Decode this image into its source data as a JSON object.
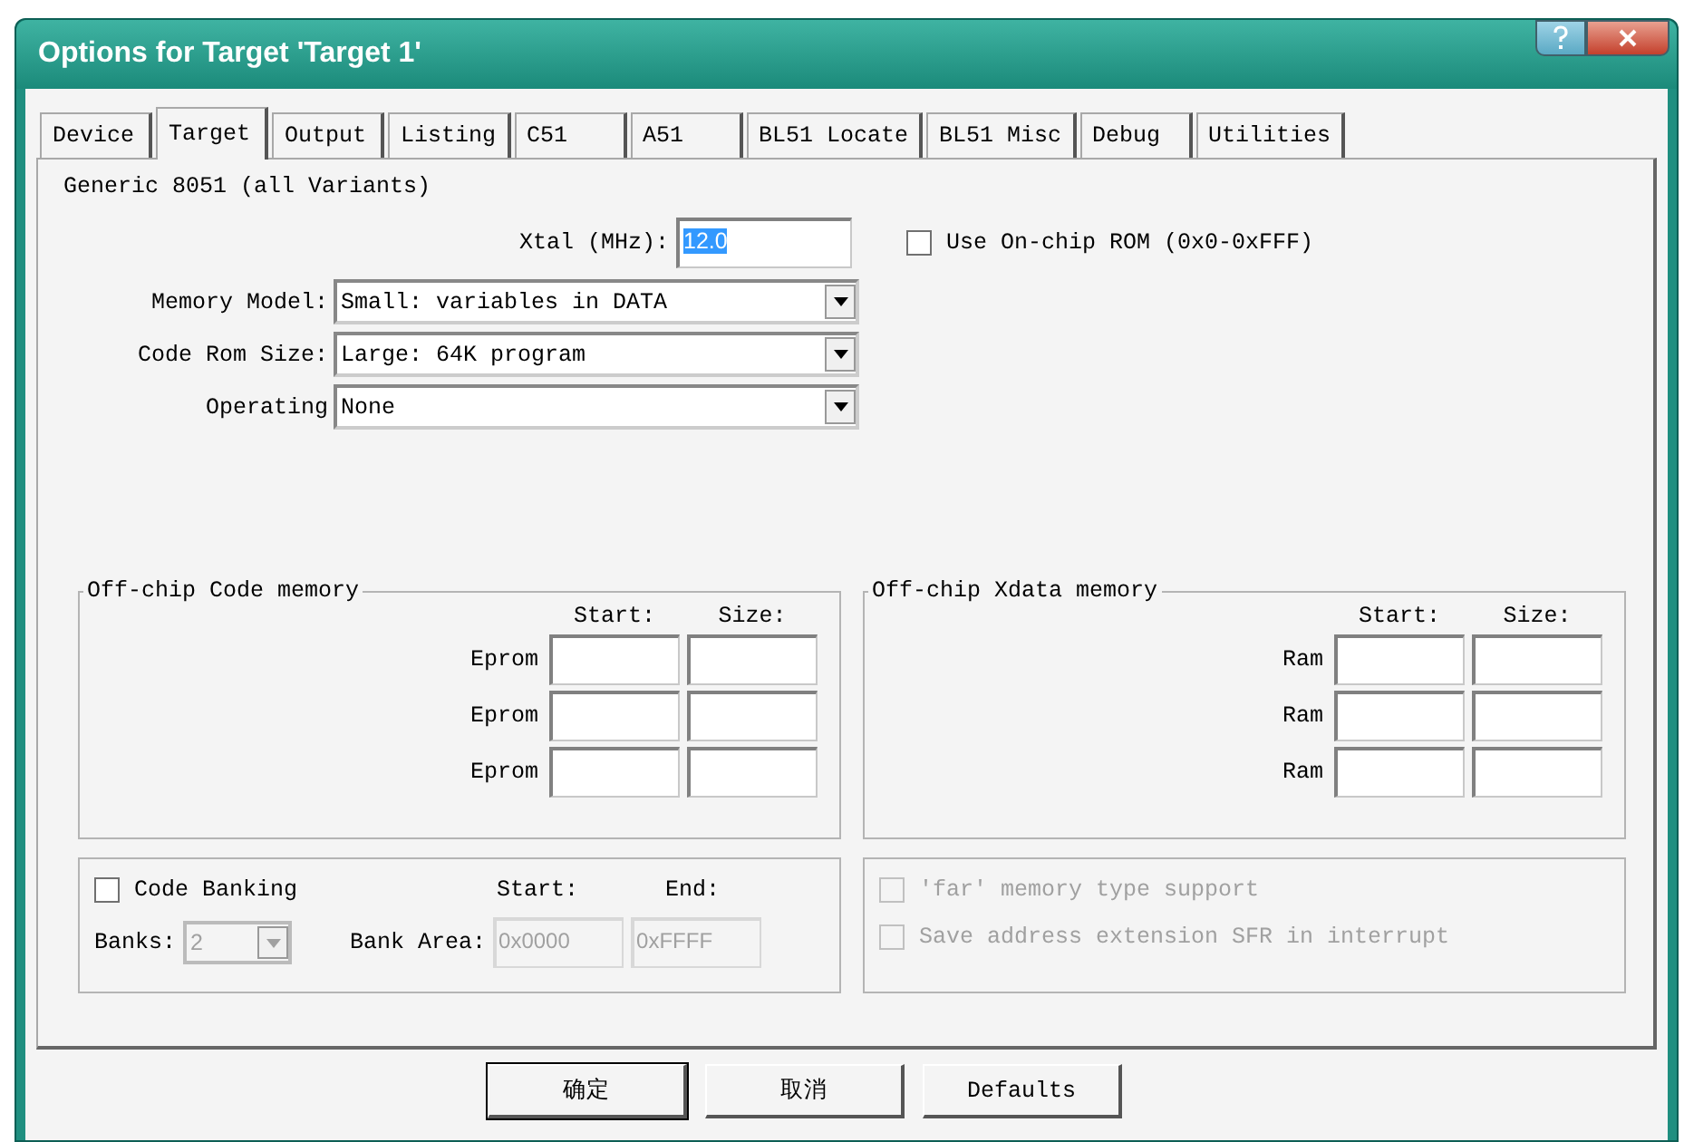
{
  "window": {
    "title": "Options for Target 'Target 1'"
  },
  "tabs": [
    {
      "label": "Device",
      "selected": false
    },
    {
      "label": "Target",
      "selected": true
    },
    {
      "label": "Output",
      "selected": false
    },
    {
      "label": "Listing",
      "selected": false
    },
    {
      "label": "C51",
      "selected": false
    },
    {
      "label": "A51",
      "selected": false
    },
    {
      "label": "BL51 Locate",
      "selected": false
    },
    {
      "label": "BL51 Misc",
      "selected": false
    },
    {
      "label": "Debug",
      "selected": false
    },
    {
      "label": "Utilities",
      "selected": false
    }
  ],
  "device_name": "Generic 8051 (all Variants)",
  "xtal": {
    "label": "Xtal (MHz):",
    "value": "12.0",
    "highlighted": true
  },
  "on_chip_rom": {
    "label": "Use On-chip ROM (0x0-0xFFF)",
    "checked": false
  },
  "selects": [
    {
      "label": "Memory Model:",
      "value": "Small: variables in DATA"
    },
    {
      "label": "Code Rom Size:",
      "value": "Large: 64K program"
    },
    {
      "label": "Operating",
      "value": "None"
    }
  ],
  "memory_groups": [
    {
      "title": "Off-chip Code memory",
      "headers": [
        "Start:",
        "Size:"
      ],
      "rows": [
        {
          "label": "Eprom"
        },
        {
          "label": "Eprom"
        },
        {
          "label": "Eprom"
        }
      ]
    },
    {
      "title": "Off-chip Xdata memory",
      "headers": [
        "Start:",
        "Size:"
      ],
      "rows": [
        {
          "label": "Ram"
        },
        {
          "label": "Ram"
        },
        {
          "label": "Ram"
        }
      ]
    }
  ],
  "code_banking": {
    "label": "Code Banking",
    "checked": false,
    "start_header": "Start:",
    "end_header": "End:",
    "banks_label": "Banks:",
    "banks_value": "2",
    "bank_area_label": "Bank Area:",
    "start_value": "0x0000",
    "end_value": "0xFFFF",
    "disabled": true
  },
  "options": [
    {
      "label": "'far' memory type support",
      "checked": false,
      "disabled": true
    },
    {
      "label": "Save address extension SFR in interrupt",
      "checked": false,
      "disabled": true
    }
  ],
  "buttons": [
    {
      "label": "确定",
      "default": true
    },
    {
      "label": "取消",
      "default": false
    },
    {
      "label": "Defaults",
      "default": false
    }
  ]
}
